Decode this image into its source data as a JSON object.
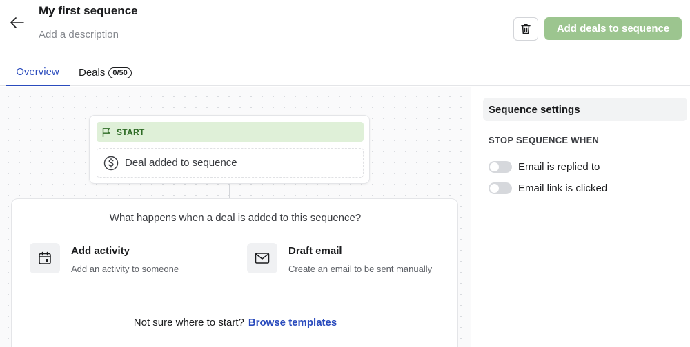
{
  "header": {
    "title": "My first sequence",
    "description_placeholder": "Add a description",
    "add_deals_label": "Add deals to sequence"
  },
  "tabs": [
    {
      "label": "Overview",
      "active": true
    },
    {
      "label": "Deals",
      "badge": "0/50",
      "active": false
    }
  ],
  "flow": {
    "start_label": "START",
    "trigger_label": "Deal added to sequence"
  },
  "prompt": {
    "title": "What happens when a deal is added to this sequence?",
    "options": [
      {
        "title": "Add activity",
        "subtitle": "Add an activity to someone",
        "icon": "calendar-icon"
      },
      {
        "title": "Draft email",
        "subtitle": "Create an email to be sent manually",
        "icon": "envelope-icon"
      }
    ],
    "help_text": "Not sure where to start?",
    "help_link": "Browse templates"
  },
  "settings": {
    "title": "Sequence settings",
    "stop_label": "STOP SEQUENCE WHEN",
    "toggles": [
      {
        "label": "Email is replied to",
        "on": false
      },
      {
        "label": "Email link is clicked",
        "on": false
      }
    ]
  },
  "colors": {
    "accent": "#2a4bbd",
    "primary_button": "#9cc58f",
    "start_pill": "#dff0d8",
    "start_text": "#2e6b25"
  }
}
